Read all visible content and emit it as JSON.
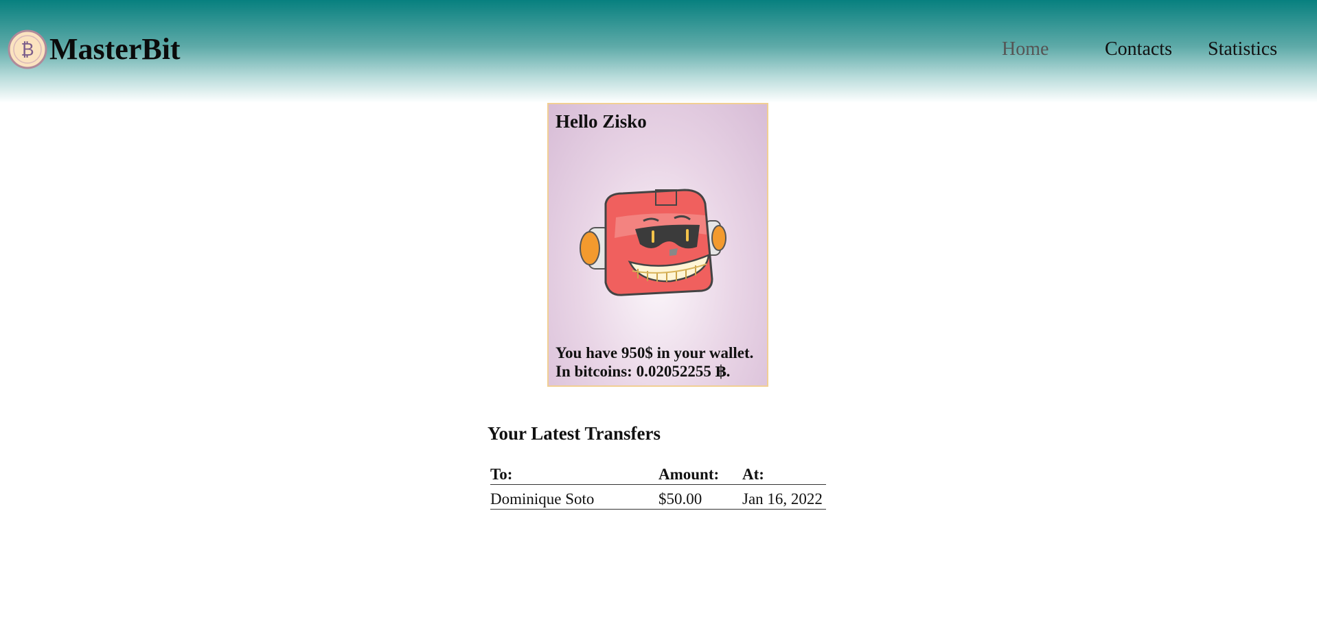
{
  "header": {
    "brand": "MasterBit",
    "logo_icon": "bitcoin-coin-icon",
    "nav": [
      {
        "label": "Home",
        "active": true
      },
      {
        "label": "Contacts",
        "active": false
      },
      {
        "label": "Statistics",
        "active": false
      }
    ]
  },
  "card": {
    "greeting": "Hello Zisko",
    "avatar_icon": "robot-avatar",
    "wallet_line": "You have 950$ in your wallet.",
    "bitcoin_line": "In bitcoins: 0.02052255 ฿."
  },
  "transfers": {
    "title": "Your Latest Transfers",
    "columns": [
      "To:",
      "Amount:",
      "At:"
    ],
    "rows": [
      {
        "to": "Dominique Soto",
        "amount": "$50.00",
        "at": "Jan 16, 2022"
      }
    ]
  },
  "colors": {
    "header_top": "#07807f",
    "card_border": "#f1cf93",
    "card_bg": "#e9d5e6",
    "robot_red": "#f0605e"
  }
}
